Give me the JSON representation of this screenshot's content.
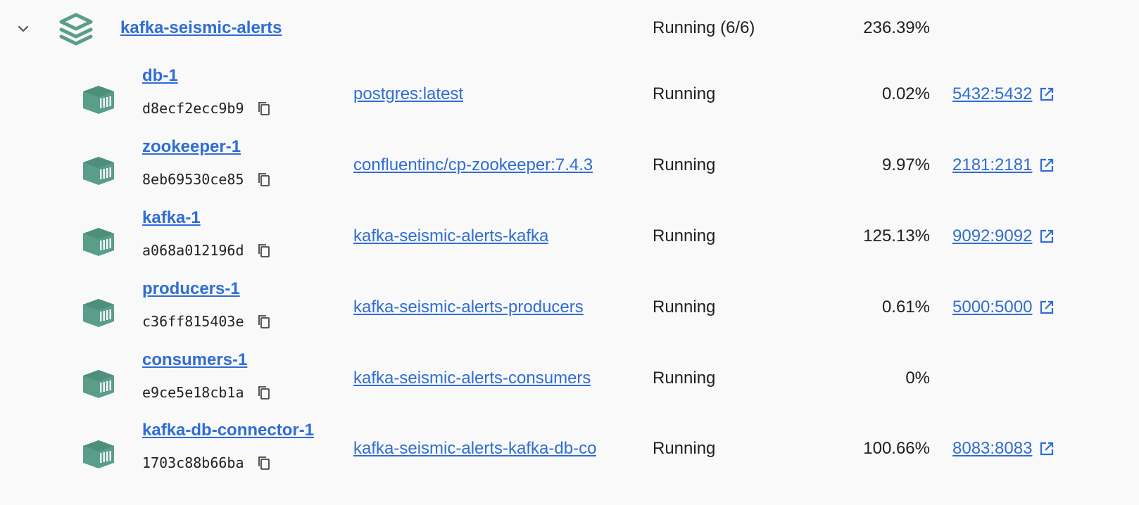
{
  "group": {
    "name": "kafka-seismic-alerts",
    "status": "Running (6/6)",
    "cpu": "236.39%",
    "icon": "layers-icon",
    "color": "#5a9e8a"
  },
  "containers": [
    {
      "name": "db-1",
      "id": "d8ecf2ecc9b9",
      "image": "postgres:latest",
      "status": "Running",
      "cpu": "0.02%",
      "port": "5432:5432"
    },
    {
      "name": "zookeeper-1",
      "id": "8eb69530ce85",
      "image": "confluentinc/cp-zookeeper:7.4.3",
      "status": "Running",
      "cpu": "9.97%",
      "port": "2181:2181"
    },
    {
      "name": "kafka-1",
      "id": "a068a012196d",
      "image": "kafka-seismic-alerts-kafka",
      "status": "Running",
      "cpu": "125.13%",
      "port": "9092:9092"
    },
    {
      "name": "producers-1",
      "id": "c36ff815403e",
      "image": "kafka-seismic-alerts-producers",
      "status": "Running",
      "cpu": "0.61%",
      "port": "5000:5000"
    },
    {
      "name": "consumers-1",
      "id": "e9ce5e18cb1a",
      "image": "kafka-seismic-alerts-consumers",
      "status": "Running",
      "cpu": "0%",
      "port": ""
    },
    {
      "name": "kafka-db-connector-1",
      "id": "1703c88b66ba",
      "image": "kafka-seismic-alerts-kafka-db-co",
      "status": "Running",
      "cpu": "100.66%",
      "port": "8083:8083"
    }
  ],
  "colors": {
    "link": "#2f6dd3",
    "icon": "#5a9e8a",
    "text": "#1f1f1f",
    "background": "#f9f9fa"
  }
}
